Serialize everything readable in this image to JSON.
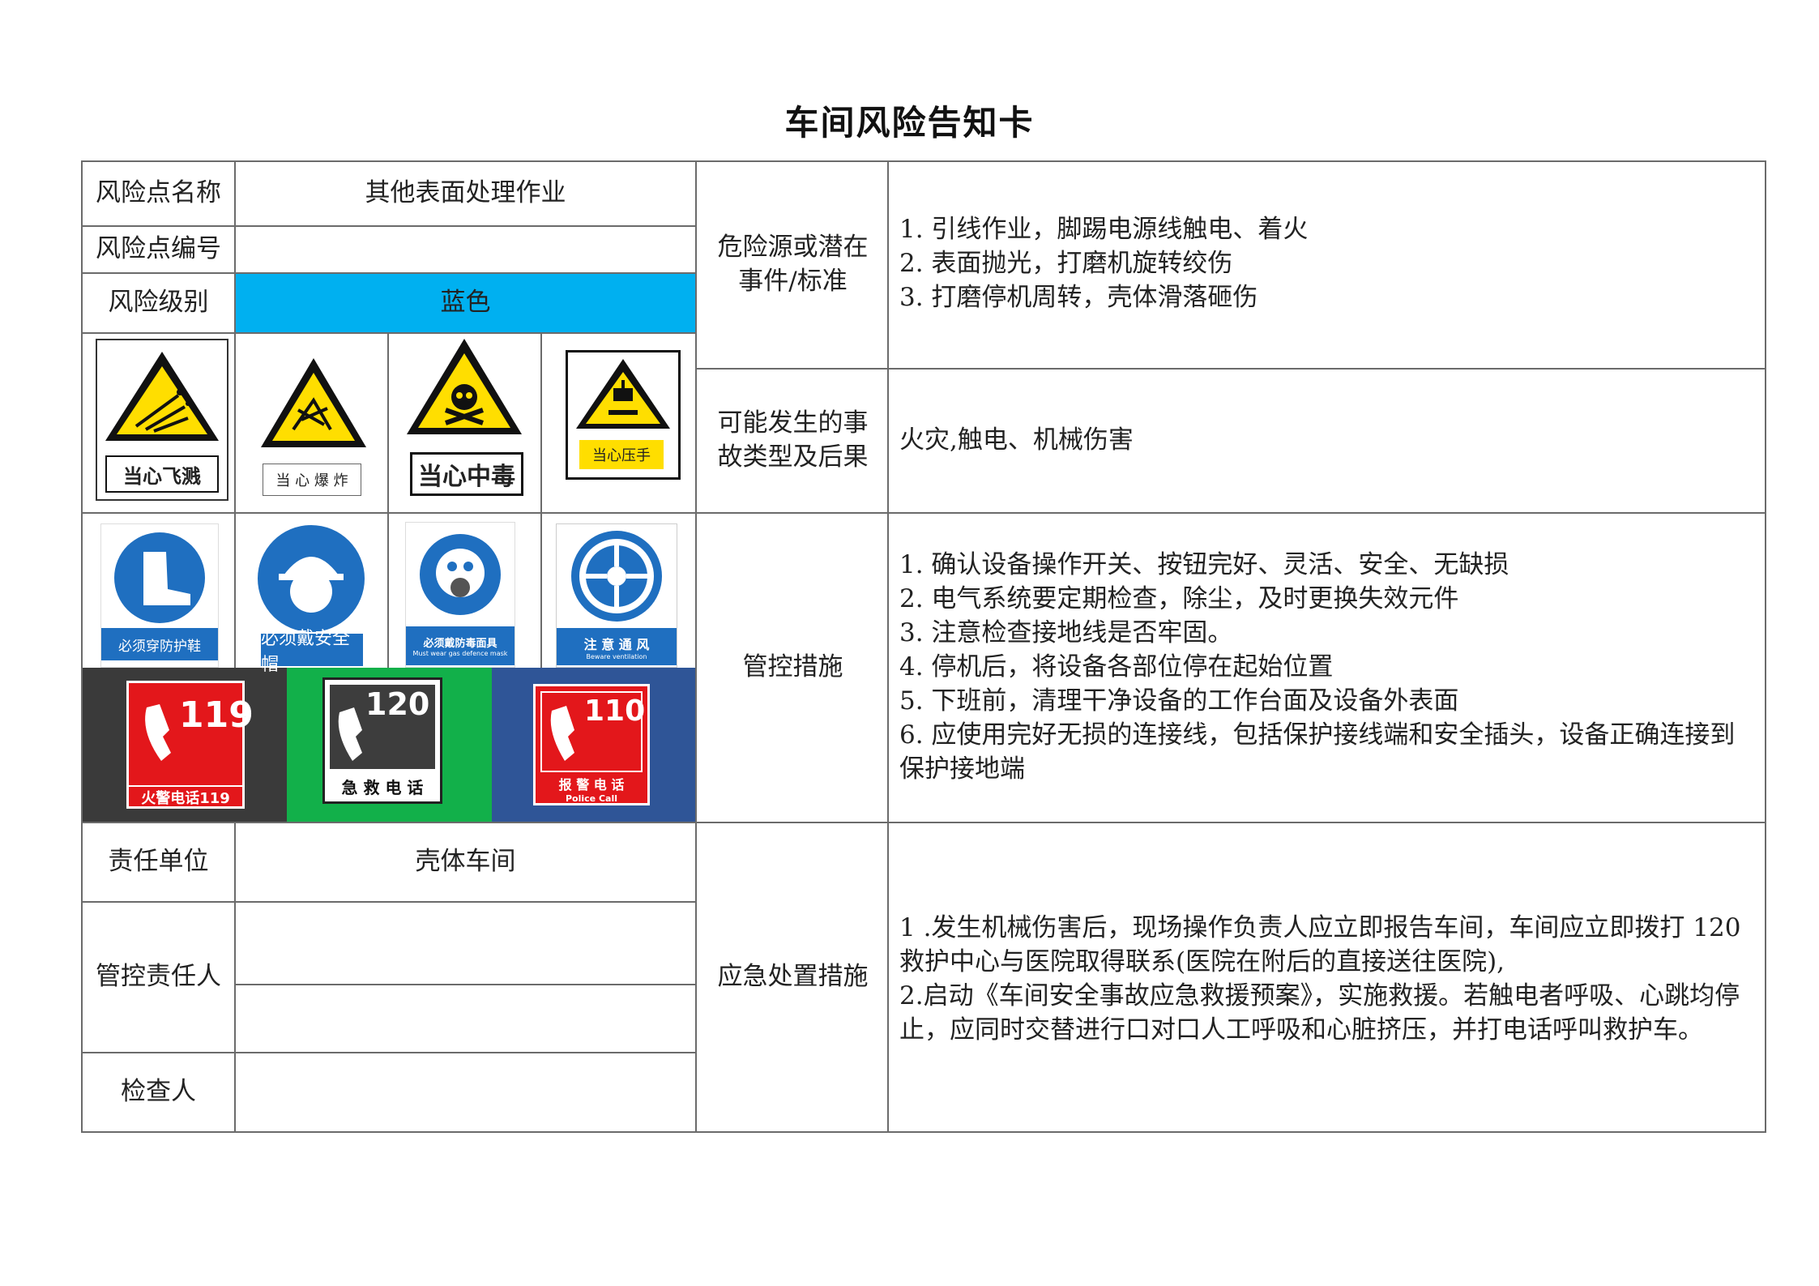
{
  "title": "车间风险告知卡",
  "labels": {
    "name": "风险点名称",
    "code": "风险点编号",
    "level": "风险级别",
    "hazard": "危险源或潜在事件/标准",
    "accident": "可能发生的事故类型及后果",
    "control": "管控措施",
    "unit": "责任单位",
    "person": "管控责任人",
    "checker": "检查人",
    "emergency": "应急处置措施"
  },
  "values": {
    "name": "其他表面处理作业",
    "code": "",
    "level": "蓝色",
    "unit": "壳体车间",
    "person": "",
    "person2": "",
    "checker": ""
  },
  "hazards": [
    "1. 引线作业，脚踢电源线触电、着火",
    "2. 表面抛光，打磨机旋转绞伤",
    "3. 打磨停机周转，壳体滑落砸伤"
  ],
  "accident_text": "火灾,触电、机械伤害",
  "controls": [
    "1. 确认设备操作开关、按钮完好、灵活、安全、无缺损",
    "2. 电气系统要定期检查，除尘，及时更换失效元件",
    "3. 注意检查接地线是否牢固。",
    "4. 停机后，将设备各部位停在起始位置",
    "5. 下班前，清理干净设备的工作台面及设备外表面",
    "6. 应使用完好无损的连接线，包括保护接线端和安全插头，设备正确连接到保护接地端"
  ],
  "emergency": [
    "1 .发生机械伤害后，现场操作负责人应立即报告车间，车间应立即拨打 120 救护中心与医院取得联系(医院在附后的直接送往医院),",
    "2.启动《车间安全事故应急救援预案》，实施救援。若触电者呼吸、心跳均停止，应同时交替进行口对口人工呼吸和心脏挤压，并打电话呼叫救护车。"
  ],
  "warning_signs": [
    {
      "icon": "flying-debris-icon",
      "label": "当心飞溅"
    },
    {
      "icon": "explosion-icon",
      "label": "当 心 爆 炸"
    },
    {
      "icon": "poison-icon",
      "label": "当心中毒"
    },
    {
      "icon": "crush-hand-icon",
      "label": "当心压手"
    }
  ],
  "mandatory_signs": [
    {
      "icon": "protective-boots-icon",
      "label": "必须穿防护鞋"
    },
    {
      "icon": "safety-helmet-icon",
      "label": "必须戴安全帽"
    },
    {
      "icon": "gas-mask-icon",
      "label": "必须戴防毒面具",
      "sub": "Must wear gas defence mask"
    },
    {
      "icon": "ventilation-icon",
      "label": "注 意 通 风",
      "sub": "Beware ventilation"
    }
  ],
  "phone_signs": [
    {
      "icon": "fire-phone-icon",
      "number": "119",
      "label": "火警电话119"
    },
    {
      "icon": "ambulance-phone-icon",
      "number": "120",
      "label": "急 救 电 话"
    },
    {
      "icon": "police-phone-icon",
      "number": "110",
      "label": "报 警 电 话",
      "sub": "Police Call"
    }
  ],
  "colors": {
    "risk_level_blue": "#00b0f0",
    "warning_yellow": "#ffde00",
    "mandatory_blue": "#1f6fc0",
    "phone_red": "#e3171b",
    "panel_dark": "#3a3a3a",
    "panel_green": "#12b04a",
    "panel_navy": "#2f5597"
  }
}
